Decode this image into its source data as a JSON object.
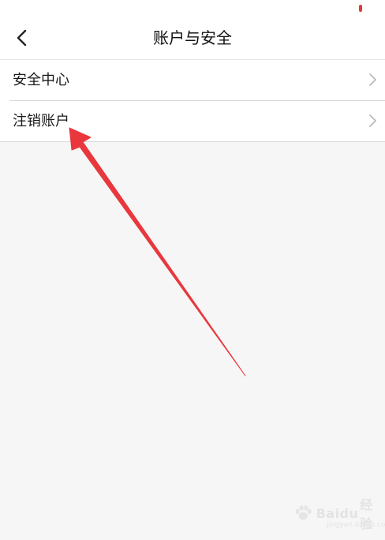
{
  "status_bar": {
    "indicator_color": "#e53935"
  },
  "header": {
    "back_icon": "chevron-left-icon",
    "title": "账户与安全"
  },
  "menu": {
    "items": [
      {
        "label": "安全中心",
        "icon": "chevron-right-icon"
      },
      {
        "label": "注销账户",
        "icon": "chevron-right-icon"
      }
    ]
  },
  "annotation": {
    "arrow_color": "#e8383d",
    "points_to": "注销账户"
  },
  "watermark": {
    "brand": "Baidu",
    "product": "经验",
    "url": "jingyan.baidu.com"
  }
}
